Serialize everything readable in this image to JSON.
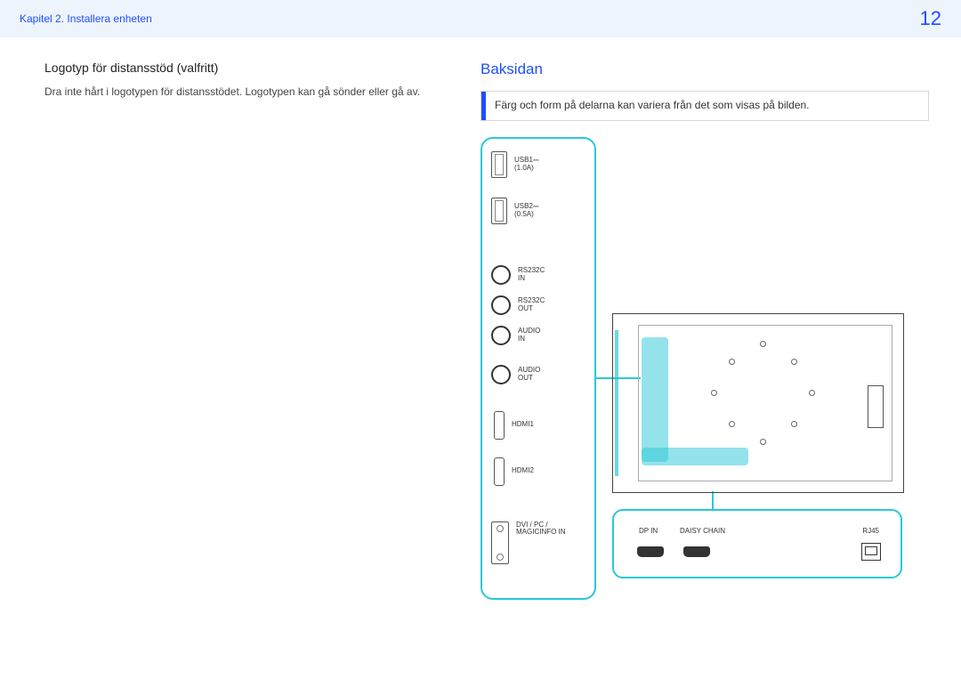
{
  "header": {
    "chapter": "Kapitel 2. Installera enheten",
    "page_number": "12"
  },
  "left": {
    "title": "Logotyp för distansstöd (valfritt)",
    "body": "Dra inte hårt i logotypen för distansstödet. Logotypen kan gå sönder eller gå av."
  },
  "right": {
    "title": "Baksidan",
    "note": "Färg och form på delarna kan variera från det som visas på bilden."
  },
  "side_ports": {
    "usb1": "USB1",
    "usb1_sub": "(1.0A)",
    "usb2": "USB2",
    "usb2_sub": "(0.5A)",
    "rs232c_in": "RS232C\nIN",
    "rs232c_out": "RS232C\nOUT",
    "audio_in": "AUDIO\nIN",
    "audio_out": "AUDIO\nOUT",
    "hdmi1": "HDMI1",
    "hdmi2": "HDMI2",
    "dvi": "DVI / PC /\nMAGICINFO IN"
  },
  "bottom_ports": {
    "dp_in": "DP IN",
    "daisy": "DAISY CHAIN",
    "rj45": "RJ45"
  }
}
